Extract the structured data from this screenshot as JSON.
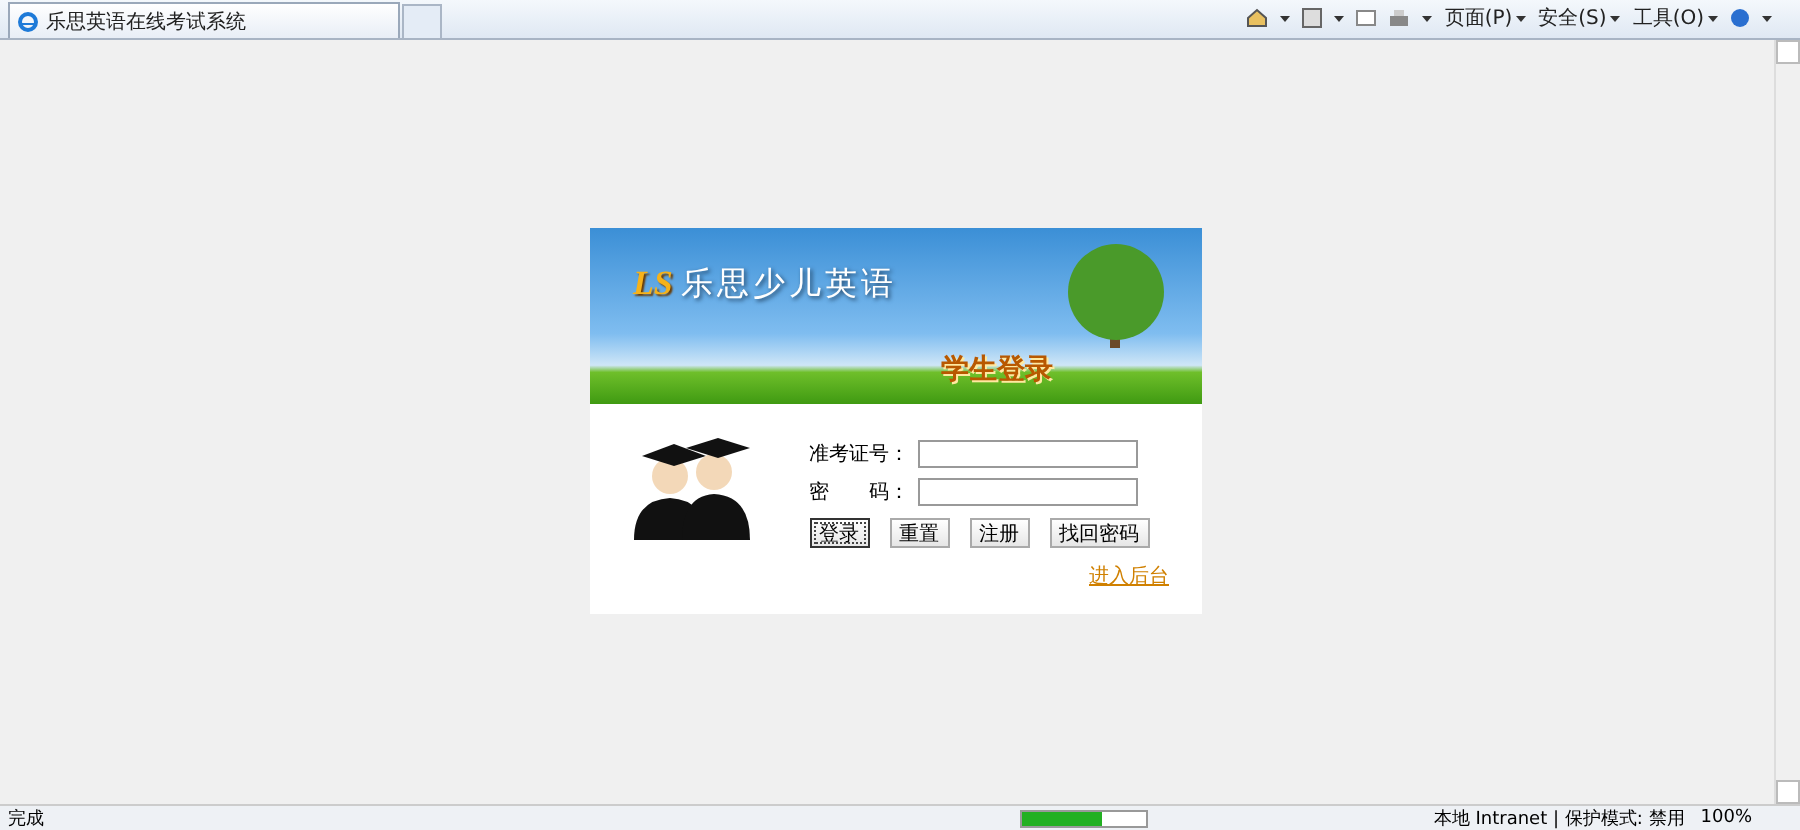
{
  "browser": {
    "tab_title": "乐思英语在线考试系统",
    "menus": [
      "页面(P)",
      "安全(S)",
      "工具(O)"
    ]
  },
  "banner": {
    "logo": "LS",
    "brand": "乐思少儿英语",
    "caption": "学生登录"
  },
  "form": {
    "fields": [
      {
        "label": "准考证号："
      },
      {
        "label": "密　　码："
      }
    ],
    "buttons": [
      {
        "label": "登录",
        "focused": true
      },
      {
        "label": "重置",
        "focused": false
      },
      {
        "label": "注册",
        "focused": false
      },
      {
        "label": "找回密码",
        "focused": false
      }
    ],
    "admin_link": "进入后台"
  },
  "status_bar": {
    "status": "完成",
    "progress": {
      "level": 0.65
    },
    "zone": "本地 Intranet | 保护模式: 禁用",
    "zoom": "100%"
  }
}
